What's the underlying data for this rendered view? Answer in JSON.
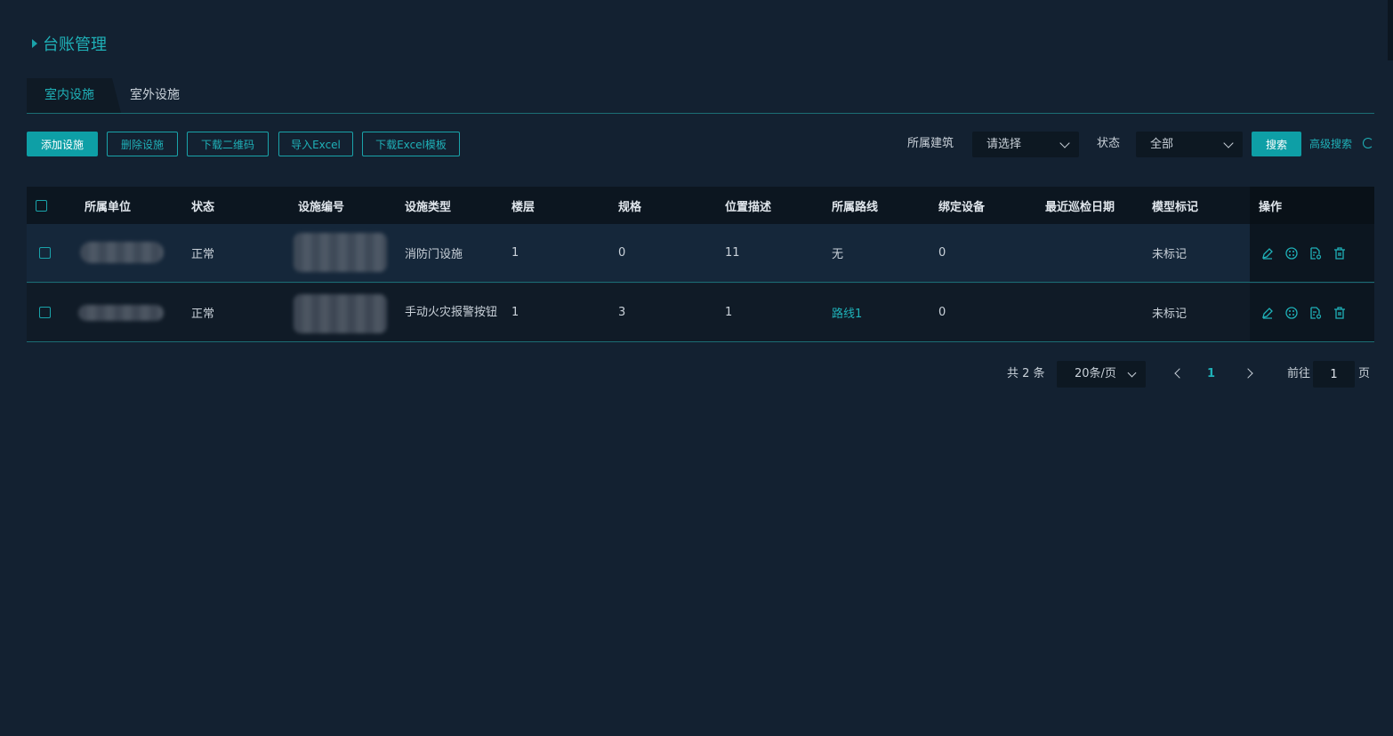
{
  "page": {
    "title": "台账管理"
  },
  "tabs": [
    {
      "label": "室内设施",
      "active": true
    },
    {
      "label": "室外设施",
      "active": false
    }
  ],
  "toolbar": {
    "add": "添加设施",
    "delete": "删除设施",
    "download_qr": "下载二维码",
    "import_excel": "导入Excel",
    "download_template": "下载Excel模板"
  },
  "filters": {
    "building_label": "所属建筑",
    "building_placeholder": "请选择",
    "status_label": "状态",
    "status_value": "全部",
    "search": "搜索",
    "advanced_search": "高级搜索"
  },
  "table": {
    "headers": [
      "所属单位",
      "状态",
      "设施编号",
      "设施类型",
      "楼层",
      "规格",
      "位置描述",
      "所属路线",
      "绑定设备",
      "最近巡检日期",
      "模型标记",
      "操作"
    ],
    "rows": [
      {
        "status": "正常",
        "type": "消防门设施",
        "floor": "1",
        "spec": "0",
        "location": "11",
        "route": "无",
        "bound": "0",
        "last_date": "",
        "model_mark": "未标记"
      },
      {
        "status": "正常",
        "type": "手动火灾报警按钮",
        "floor": "1",
        "spec": "3",
        "location": "1",
        "route": "路线1",
        "bound": "0",
        "last_date": "",
        "model_mark": "未标记"
      }
    ]
  },
  "pagination": {
    "total": "共 2 条",
    "page_size": "20条/页",
    "current_page": "1",
    "goto_label": "前往",
    "goto_value": "1",
    "page_unit": "页"
  },
  "colors": {
    "accent": "#1fb1b8",
    "background": "#132131",
    "header": "#0c1620"
  },
  "icons": [
    "triangle-right-icon",
    "edit-icon",
    "model-icon",
    "document-icon",
    "trash-icon",
    "refresh-icon",
    "chevron-down-icon",
    "chevron-left-icon",
    "chevron-right-icon"
  ]
}
